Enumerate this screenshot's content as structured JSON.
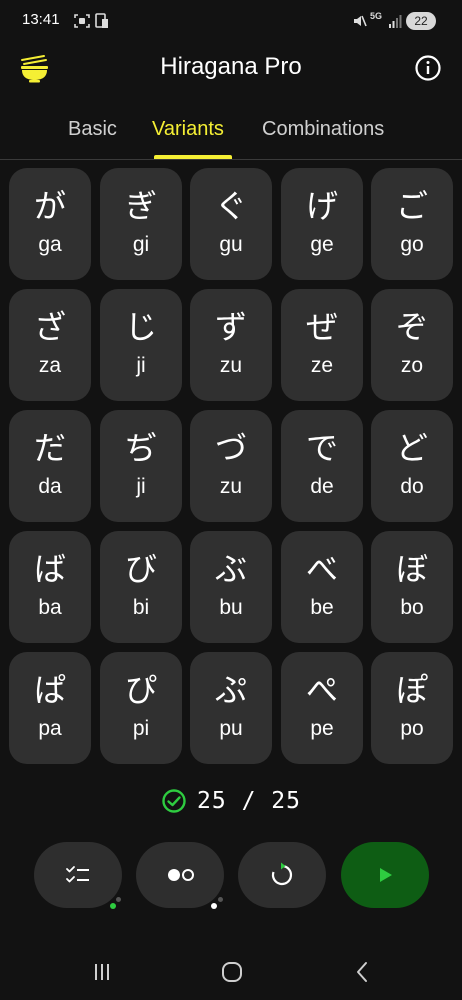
{
  "status_bar": {
    "time": "13:41",
    "battery": "22",
    "network": "5G"
  },
  "app": {
    "title": "Hiragana Pro",
    "logo_icon": "noodle-bowl-icon",
    "accent_color": "#f5ef34"
  },
  "tabs": [
    {
      "label": "Basic",
      "active": false
    },
    {
      "label": "Variants",
      "active": true
    },
    {
      "label": "Combinations",
      "active": false
    }
  ],
  "cards": [
    {
      "kana": "が",
      "romaji": "ga"
    },
    {
      "kana": "ぎ",
      "romaji": "gi"
    },
    {
      "kana": "ぐ",
      "romaji": "gu"
    },
    {
      "kana": "げ",
      "romaji": "ge"
    },
    {
      "kana": "ご",
      "romaji": "go"
    },
    {
      "kana": "ざ",
      "romaji": "za"
    },
    {
      "kana": "じ",
      "romaji": "ji"
    },
    {
      "kana": "ず",
      "romaji": "zu"
    },
    {
      "kana": "ぜ",
      "romaji": "ze"
    },
    {
      "kana": "ぞ",
      "romaji": "zo"
    },
    {
      "kana": "だ",
      "romaji": "da"
    },
    {
      "kana": "ぢ",
      "romaji": "ji"
    },
    {
      "kana": "づ",
      "romaji": "zu"
    },
    {
      "kana": "で",
      "romaji": "de"
    },
    {
      "kana": "ど",
      "romaji": "do"
    },
    {
      "kana": "ば",
      "romaji": "ba"
    },
    {
      "kana": "び",
      "romaji": "bi"
    },
    {
      "kana": "ぶ",
      "romaji": "bu"
    },
    {
      "kana": "べ",
      "romaji": "be"
    },
    {
      "kana": "ぼ",
      "romaji": "bo"
    },
    {
      "kana": "ぱ",
      "romaji": "pa"
    },
    {
      "kana": "ぴ",
      "romaji": "pi"
    },
    {
      "kana": "ぷ",
      "romaji": "pu"
    },
    {
      "kana": "ぺ",
      "romaji": "pe"
    },
    {
      "kana": "ぽ",
      "romaji": "po"
    }
  ],
  "score": {
    "text": "25 / 25",
    "icon": "check-circle-icon",
    "color": "#2ecc40"
  },
  "actions": [
    {
      "name": "checklist-button",
      "icon": "checklist-icon"
    },
    {
      "name": "display-mode-button",
      "icon": "dots-toggle-icon"
    },
    {
      "name": "reset-button",
      "icon": "refresh-icon"
    },
    {
      "name": "play-button",
      "icon": "play-icon"
    }
  ],
  "navigation": [
    {
      "name": "recents-button",
      "icon": "recents-icon"
    },
    {
      "name": "home-button",
      "icon": "home-icon"
    },
    {
      "name": "back-button",
      "icon": "back-icon"
    }
  ]
}
